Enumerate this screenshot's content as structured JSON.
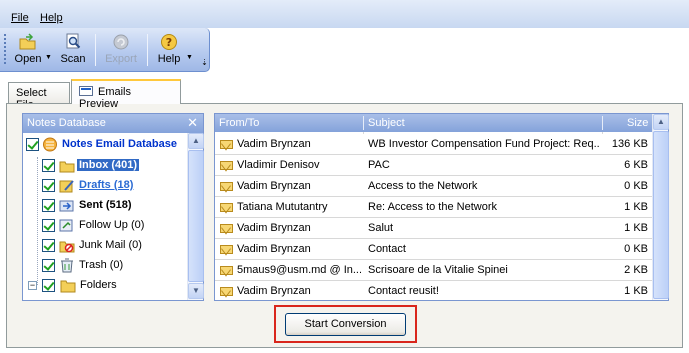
{
  "menu": {
    "file": "File",
    "help": "Help"
  },
  "toolbar": {
    "open": "Open",
    "scan": "Scan",
    "export": "Export",
    "help": "Help"
  },
  "tabs": {
    "select_file": "Select File",
    "emails_preview": "Emails Preview"
  },
  "tree": {
    "header": "Notes Database",
    "root": "Notes Email Database",
    "items": [
      {
        "label": "Inbox (401)",
        "icon": "inbox-folder-icon"
      },
      {
        "label": "Drafts (18)",
        "icon": "drafts-icon"
      },
      {
        "label": "Sent (518)",
        "icon": "sent-icon"
      },
      {
        "label": "Follow Up (0)",
        "icon": "follow-up-icon"
      },
      {
        "label": "Junk Mail (0)",
        "icon": "junk-mail-icon"
      },
      {
        "label": "Trash (0)",
        "icon": "trash-icon"
      },
      {
        "label": "Folders",
        "icon": "folder-icon"
      }
    ]
  },
  "grid": {
    "columns": [
      "From/To",
      "Subject",
      "Size"
    ],
    "rows": [
      {
        "from": "Vadim Brynzan",
        "subject": "WB Investor Compensation Fund Project: Req...",
        "size": "136 KB"
      },
      {
        "from": "Vladimir Denisov",
        "subject": "PAC",
        "size": "6 KB"
      },
      {
        "from": "Vadim Brynzan",
        "subject": "Access to the Network",
        "size": "0 KB"
      },
      {
        "from": "Tatiana Mututantry",
        "subject": "Re: Access to the Network",
        "size": "1 KB"
      },
      {
        "from": "Vadim Brynzan",
        "subject": "Salut",
        "size": "1 KB"
      },
      {
        "from": "Vadim Brynzan",
        "subject": "Contact",
        "size": "0 KB"
      },
      {
        "from": "5maus9@usm.md @ In...",
        "subject": "Scrisoare de la Vitalie Spinei",
        "size": "2 KB"
      },
      {
        "from": "Vadim Brynzan",
        "subject": "Contact reusit!",
        "size": "1 KB"
      }
    ]
  },
  "actions": {
    "start_conversion": "Start Conversion"
  },
  "colors": {
    "highlight_box": "#d9261c",
    "selection": "#316ac5",
    "db_label": "#0033cc"
  }
}
